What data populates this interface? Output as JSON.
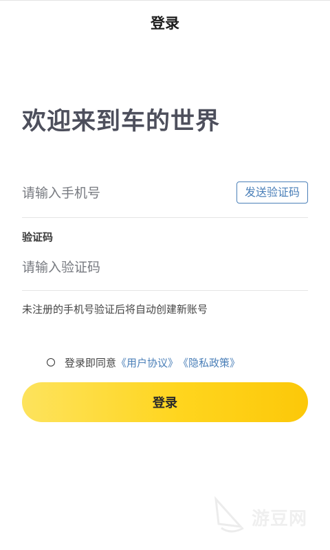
{
  "header": {
    "title": "登录"
  },
  "welcome_title": "欢迎来到车的世界",
  "phone": {
    "placeholder": "请输入手机号",
    "send_code_label": "发送验证码"
  },
  "code": {
    "label": "验证码",
    "placeholder": "请输入验证码"
  },
  "hint": "未注册的手机号验证后将自动创建新账号",
  "agreement": {
    "prefix": "登录即同意",
    "user_agreement": "《用户协议》",
    "privacy_policy": "《隐私政策》",
    "checked": false
  },
  "login_button_label": "登录",
  "watermark": {
    "text": "游豆网",
    "icon": "sail-logo-icon"
  },
  "colors": {
    "accent_yellow": "#ffd51e",
    "link_blue": "#4a7fb8",
    "title_gray": "#4d4f5c"
  }
}
